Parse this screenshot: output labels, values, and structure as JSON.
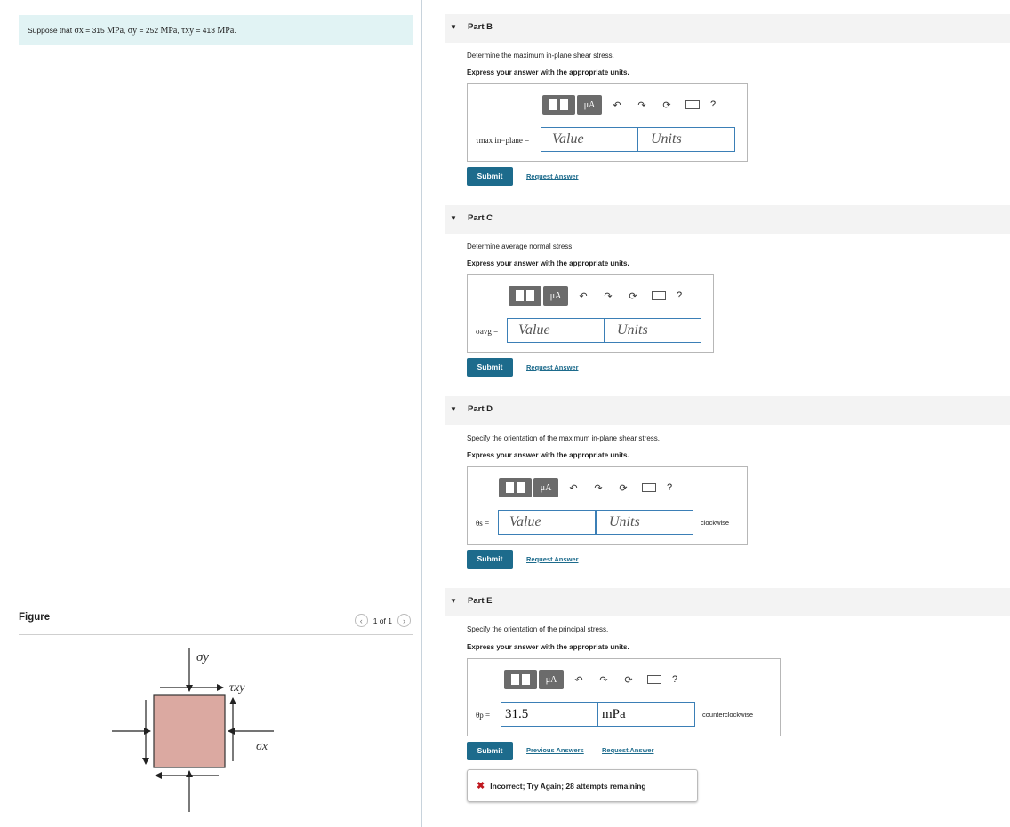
{
  "problem": {
    "prefix": "Suppose that",
    "sx_sym": "σx",
    "sx_val": "= 315",
    "sx_unit": "MPa",
    "sy_sym": "σy",
    "sy_val": "= 252",
    "sy_unit": "MPa",
    "txy_sym": "τxy",
    "txy_val": "= 413",
    "txy_unit": "MPa"
  },
  "figure": {
    "title": "Figure",
    "pager": "1 of 1",
    "labels": {
      "sigma_y": "σy",
      "tau_xy": "τxy",
      "sigma_x": "σx"
    },
    "square_color": "#dba9a1"
  },
  "toolbar": {
    "mu_label": "μA",
    "help": "?"
  },
  "parts": [
    {
      "title": "Part B",
      "question": "Determine the maximum in-plane shear stress.",
      "instruction": "Express your answer with the appropriate units.",
      "var_label": "τmax in−plane =",
      "value_placeholder": "Value",
      "units_placeholder": "Units",
      "submit": "Submit",
      "request": "Request Answer"
    },
    {
      "title": "Part C",
      "question": "Determine average normal stress.",
      "instruction": "Express your answer with the appropriate units.",
      "var_label": "σavg =",
      "value_placeholder": "Value",
      "units_placeholder": "Units",
      "submit": "Submit",
      "request": "Request Answer"
    },
    {
      "title": "Part D",
      "question": "Specify the orientation of the maximum in-plane shear stress.",
      "instruction": "Express your answer with the appropriate units.",
      "var_label": "θs =",
      "value_placeholder": "Value",
      "units_placeholder": "Units",
      "direction": "clockwise",
      "submit": "Submit",
      "request": "Request Answer"
    },
    {
      "title": "Part E",
      "question": "Specify the orientation of the principal stress.",
      "instruction": "Express your answer with the appropriate units.",
      "var_label": "θp =",
      "value": "31.5",
      "units": "mPa",
      "direction": "counterclockwise",
      "submit": "Submit",
      "previous": "Previous Answers",
      "request": "Request Answer",
      "feedback": "Incorrect; Try Again; 28 attempts remaining"
    }
  ],
  "colors": {
    "accent": "#1d6b8c",
    "intro_bg": "#e1f3f4",
    "error": "#c0181f"
  }
}
